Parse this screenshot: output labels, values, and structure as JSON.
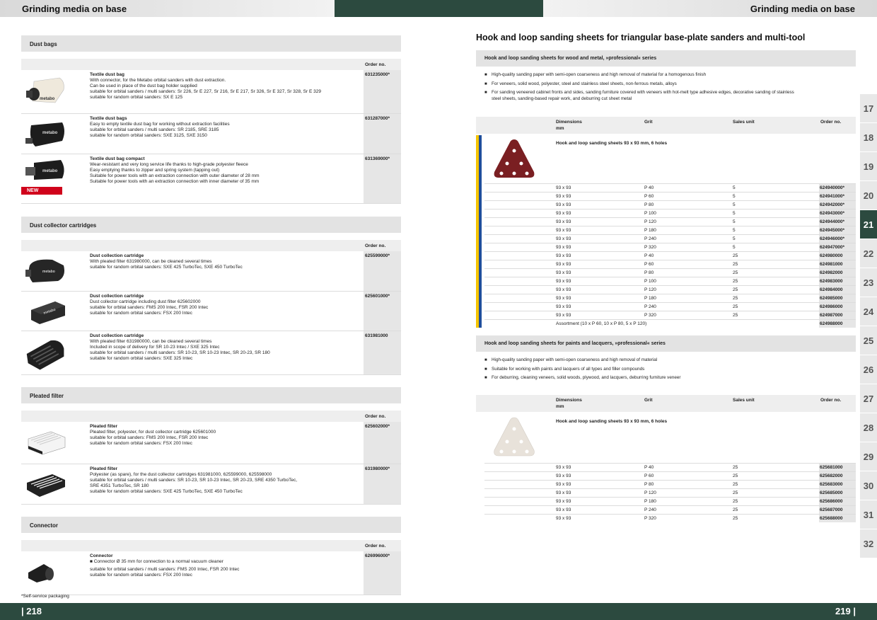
{
  "header": {
    "left_title": "Grinding media on base",
    "right_title": "Grinding media on base"
  },
  "footer": {
    "left_page": "| 218",
    "right_page": "219 |"
  },
  "left": {
    "sections": [
      {
        "title": "Dust bags",
        "order_label": "Order no.",
        "products": [
          {
            "name": "Textile dust bag",
            "lines": [
              "With connector, for the Metabo orbital sanders with dust extraction.",
              "Can be used in place of the dust bag holder supplied",
              "suitable for orbital sanders / multi sanders: Sr 226, Sr E 227, Sr 216, Sr E 217, Sr 326, Sr E 327, Sr 328, Sr E 329",
              "suitable for random orbital sanders: SX E 125"
            ],
            "order": "631235000*"
          },
          {
            "name": "Textile dust bags",
            "lines": [
              "Easy to empty textile dust bag for working without extraction facilities",
              "suitable for orbital sanders / multi sanders: SR 2185, SRE 3185",
              "suitable for random orbital sanders: SXE 3125, SXE 3150"
            ],
            "order": "631287000*"
          },
          {
            "name": "Textile dust bag compact",
            "lines": [
              "Wear-resistant and very long service life thanks to high-grade polyester fleece",
              "Easy emptying thanks to zipper and spring system (tapping out)",
              "Suitable for power tools with an extraction connection with outer diameter of 28 mm",
              "Suitable for power tools with an extraction connection with inner diameter of 35 mm"
            ],
            "order": "631369000*",
            "badge": "NEW"
          }
        ]
      },
      {
        "title": "Dust collector cartridges",
        "order_label": "Order no.",
        "products": [
          {
            "name": "Dust collection cartridge",
            "lines": [
              "With pleated filter 631980000, can be cleaned several times",
              "suitable for random orbital sanders: SXE 425 TurboTec, SXE 450 TurboTec"
            ],
            "order": "625599000*"
          },
          {
            "name": "Dust collection cartridge",
            "lines": [
              "Dust collector cartridge including dust filter 625602000",
              "suitable for orbital sanders: FMS 200 Intec, FSR 200 Intec",
              "suitable for random orbital sanders: FSX 200 Intec"
            ],
            "order": "625601000*"
          },
          {
            "name": "Dust collection cartridge",
            "lines": [
              "With pleated filter 631980000, can be cleaned several times",
              "Included in scope of delivery for SR 10-23 Intec / SXE 325 Intec",
              "suitable for orbital sanders / multi sanders: SR 10-23, SR 10-23 Intec, SR 20-23, SR 180",
              "suitable for random orbital sanders: SXE 325 Intec"
            ],
            "order": "631981000"
          }
        ]
      },
      {
        "title": "Pleated filter",
        "order_label": "Order no.",
        "products": [
          {
            "name": "Pleated filter",
            "lines": [
              "Pleated filter, polyester, for dust collector cartridge 625601000",
              "suitable for orbital sanders: FMS 200 Intec, FSR 200 Intec",
              "suitable for random orbital sanders: FSX 200 Intec"
            ],
            "order": "625602000*"
          },
          {
            "name": "Pleated filter",
            "lines": [
              "Polyester (as spare), for the dust collector cartridges 631981000, 625599000, 625598000",
              "suitable for orbital sanders / multi sanders: SR 10-23, SR 10-23 Intec, SR 20-23, SRE 4350 TurboTec,",
              "SRE 4351 TurboTec, SR 180",
              "suitable for random orbital sanders: SXE 425 TurboTec, SXE 450 TurboTec"
            ],
            "order": "631980000*"
          }
        ]
      },
      {
        "title": "Connector",
        "order_label": "Order no.",
        "products": [
          {
            "name": "Connector",
            "lines": [
              "■  Connector Ø 35 mm for connection to a normal vacuum cleaner",
              "suitable for orbital sanders / multi sanders: FMS 200 Intec, FSR 200 Intec",
              "suitable for random orbital sanders: FSX 200 Intec"
            ],
            "order": "626996000*"
          }
        ]
      }
    ],
    "footnote": "*Self-service packaging"
  },
  "right": {
    "title": "Hook and loop sanding sheets for triangular base-plate sanders and multi-tool",
    "blocks": [
      {
        "subtitle": "Hook and loop sanding sheets for wood and metal, »professional« series",
        "bullets": [
          "High-quality sanding paper with semi-open coarseness and high removal of material for a homogenous finish",
          "For veneers, solid wood, polyester, steel and stainless steel sheets, non-ferrous metals, alloys",
          "For sanding veneered cabinet fronts and sides, sanding furniture covered with veneers with hot-melt type adhesive edges, decorative sanding of stainless steel sheets, sanding-based repair work, and deburring cut sheet metal"
        ],
        "columns": [
          "Dimensions",
          "mm",
          "Grit",
          "Sales unit",
          "Order no."
        ],
        "product": "Hook and loop sanding sheets 93 x 93 mm, 6 holes",
        "rows": [
          [
            "93 x 93",
            "P 40",
            "5",
            "624940000*"
          ],
          [
            "93 x 93",
            "P 60",
            "5",
            "624941000*"
          ],
          [
            "93 x 93",
            "P 80",
            "5",
            "624942000*"
          ],
          [
            "93 x 93",
            "P 100",
            "5",
            "624943000*"
          ],
          [
            "93 x 93",
            "P 120",
            "5",
            "624944000*"
          ],
          [
            "93 x 93",
            "P 180",
            "5",
            "624945000*"
          ],
          [
            "93 x 93",
            "P 240",
            "5",
            "624946000*"
          ],
          [
            "93 x 93",
            "P 320",
            "5",
            "624947000*"
          ],
          [
            "93 x 93",
            "P 40",
            "25",
            "624980000"
          ],
          [
            "93 x 93",
            "P 60",
            "25",
            "624981000"
          ],
          [
            "93 x 93",
            "P 80",
            "25",
            "624982000"
          ],
          [
            "93 x 93",
            "P 100",
            "25",
            "624983000"
          ],
          [
            "93 x 93",
            "P 120",
            "25",
            "624984000"
          ],
          [
            "93 x 93",
            "P 180",
            "25",
            "624985000"
          ],
          [
            "93 x 93",
            "P 240",
            "25",
            "624986000"
          ],
          [
            "93 x 93",
            "P 320",
            "25",
            "624987000"
          ],
          [
            "Assortment (10 x P 60, 10 x P 80, 5 x P 120)",
            "",
            "",
            "624988000"
          ]
        ]
      },
      {
        "subtitle": "Hook and loop sanding sheets for paints and lacquers, »professional« series",
        "bullets": [
          "High-quality sanding paper with semi-open coarseness and high removal of material",
          "Suitable for working with paints and lacquers of all types and filler compounds",
          "For deburring, cleaning veneers, solid woods, plywood, and lacquers, deburring furniture veneer"
        ],
        "columns": [
          "Dimensions",
          "mm",
          "Grit",
          "Sales unit",
          "Order no."
        ],
        "product": "Hook and loop sanding sheets 93 x 93 mm, 6 holes",
        "rows": [
          [
            "93 x 93",
            "P 40",
            "25",
            "625681000"
          ],
          [
            "93 x 93",
            "P 60",
            "25",
            "625682000"
          ],
          [
            "93 x 93",
            "P 80",
            "25",
            "625683000"
          ],
          [
            "93 x 93",
            "P 120",
            "25",
            "625685000"
          ],
          [
            "93 x 93",
            "P 180",
            "25",
            "625686000"
          ],
          [
            "93 x 93",
            "P 240",
            "25",
            "625687000"
          ],
          [
            "93 x 93",
            "P 320",
            "25",
            "625688000"
          ]
        ]
      }
    ]
  },
  "tabs": {
    "items": [
      "17",
      "18",
      "19",
      "20",
      "21",
      "22",
      "23",
      "24",
      "25",
      "26",
      "27",
      "28",
      "29",
      "30",
      "31",
      "32"
    ],
    "active": "21"
  },
  "colors": {
    "brand_dark": "#2c4a3f",
    "new_badge": "#d0021b",
    "stripe_yellow": "#f5c400",
    "stripe_blue": "#1f4e9c"
  }
}
